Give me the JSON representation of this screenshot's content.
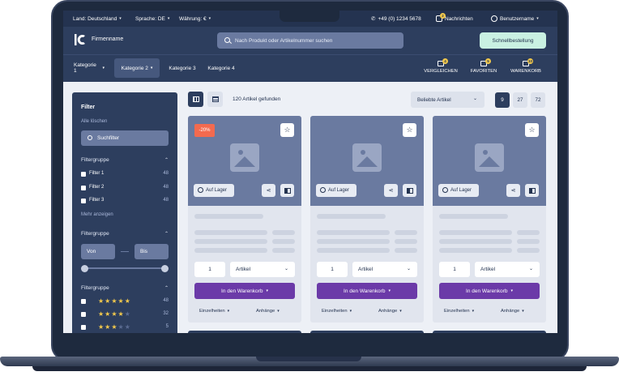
{
  "topbar": {
    "country": "Land: Deutschland",
    "language": "Sprache: DE",
    "currency": "Währung: €",
    "phone": "+49 (0) 1234 5678",
    "messages_count": "2",
    "messages": "Nachrichten",
    "user": "Benutzername"
  },
  "header": {
    "company": "Firmenname",
    "search_placeholder": "Nach Produkt oder Artikelnummer suchen",
    "quick_order": "Schnellbestellung"
  },
  "nav": {
    "categories": [
      "Kategorie 1",
      "Kategorie 2",
      "Kategorie 3",
      "Kategorie 4"
    ],
    "compare": "VERGLEICHEN",
    "compare_count": "4",
    "favorites": "FAVORITEN",
    "favorites_count": "5",
    "cart": "WARENKORB",
    "cart_count": "10"
  },
  "sidebar": {
    "title": "Filter",
    "clear": "Alle löschen",
    "search": "Suchfilter",
    "group_label": "Filtergruppe",
    "filters": [
      {
        "label": "Filter 1",
        "count": "48"
      },
      {
        "label": "Filter 2",
        "count": "48"
      },
      {
        "label": "Filter 3",
        "count": "48"
      }
    ],
    "more": "Mehr anzeigen",
    "range_from": "Von",
    "range_to": "Bis",
    "ratings": [
      {
        "stars": 5,
        "count": "48"
      },
      {
        "stars": 4,
        "count": "32"
      },
      {
        "stars": 3,
        "count": "5"
      }
    ]
  },
  "toolbar": {
    "found": "120 Artikel gefunden",
    "sort": "Beliebte Artikel",
    "per_page": [
      "9",
      "27",
      "72"
    ]
  },
  "products": [
    {
      "sale": "-20%",
      "stock": "Auf Lager",
      "qty": "1",
      "unit": "Artikel",
      "cart": "In den Warenkorb",
      "details": "Einzelheiten",
      "attachments": "Anhänge"
    },
    {
      "sale": "",
      "stock": "Auf Lager",
      "qty": "1",
      "unit": "Artikel",
      "cart": "In den Warenkorb",
      "details": "Einzelheiten",
      "attachments": "Anhänge"
    },
    {
      "sale": "",
      "stock": "Auf Lager",
      "qty": "1",
      "unit": "Artikel",
      "cart": "In den Warenkorb",
      "details": "Einzelheiten",
      "attachments": "Anhänge"
    }
  ],
  "colors": {
    "primary": "#2d3e5e",
    "accent": "#6b3aa8",
    "sale": "#f36a4f",
    "quick_order": "#c9f1e2"
  }
}
